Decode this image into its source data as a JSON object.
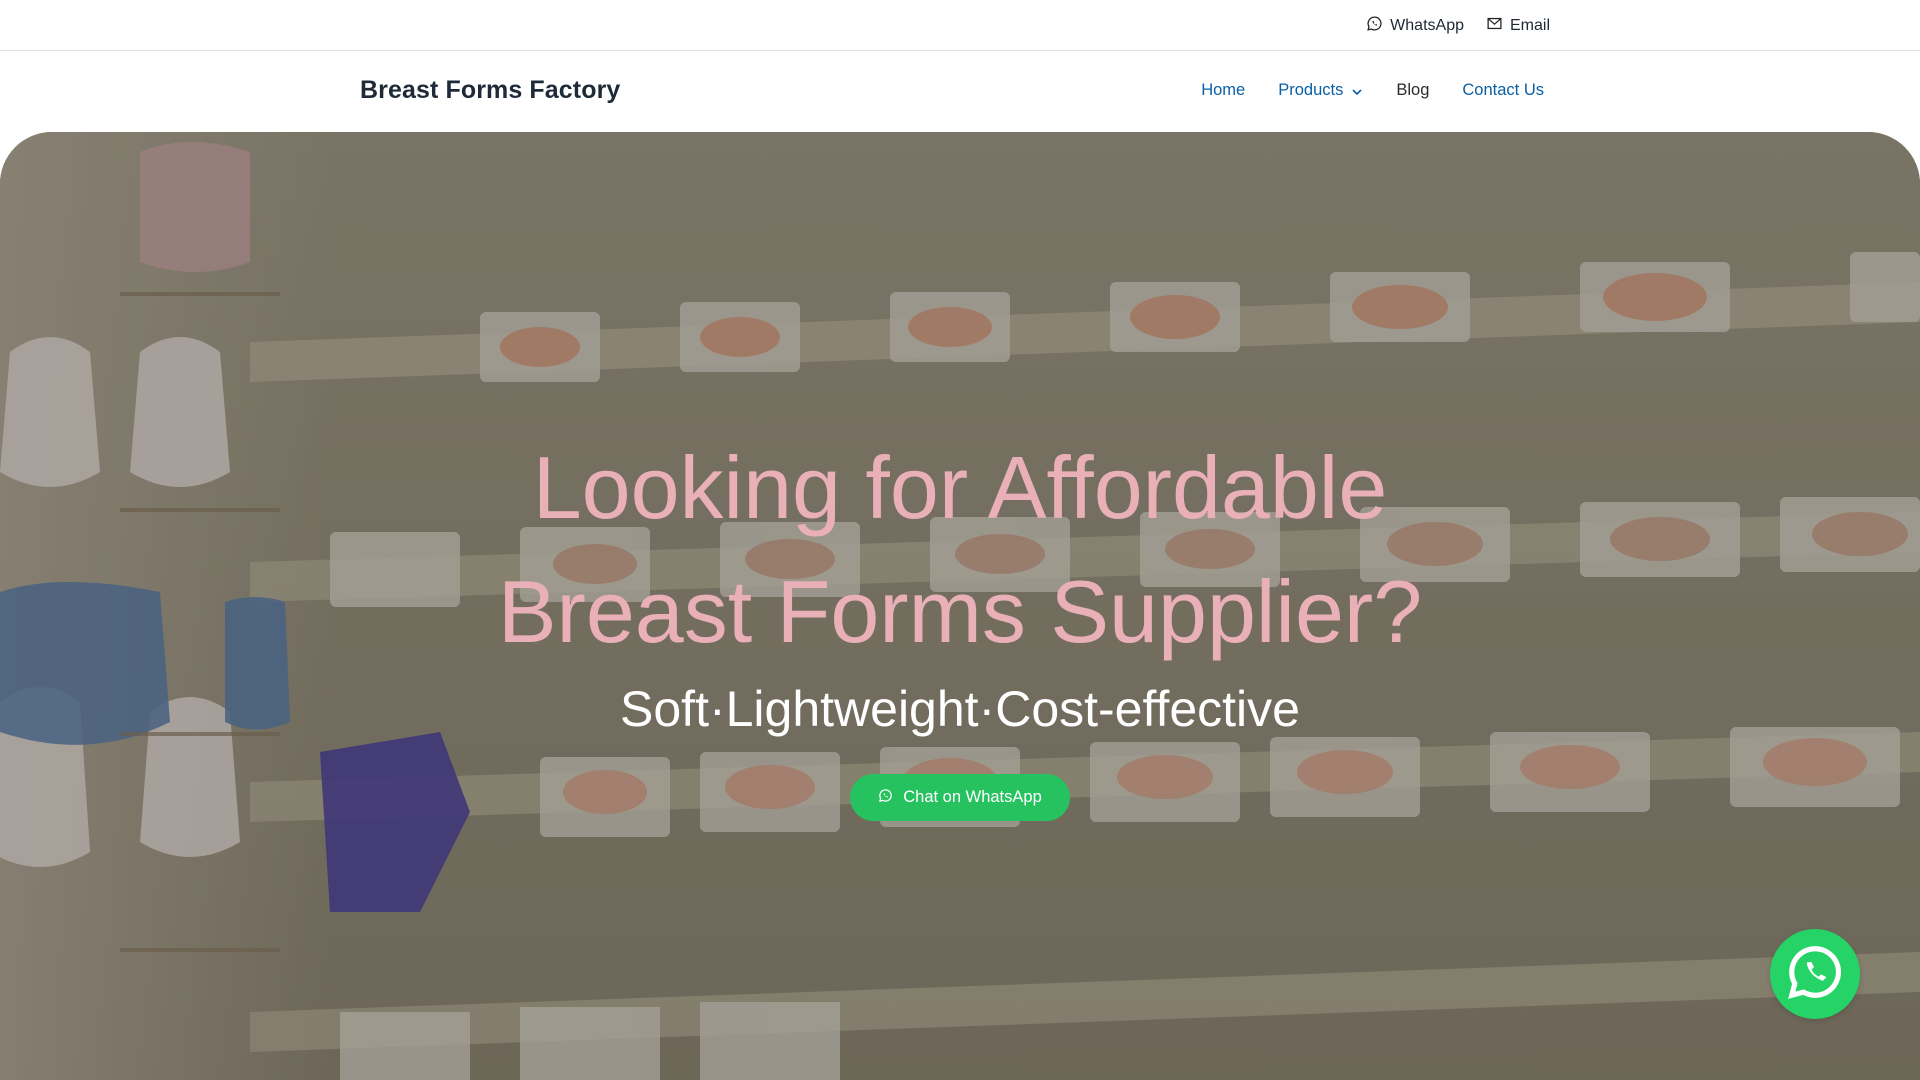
{
  "topbar": {
    "whatsapp_label": "WhatsApp",
    "email_label": "Email"
  },
  "header": {
    "brand": "Breast Forms Factory",
    "nav": {
      "home": "Home",
      "products": "Products",
      "blog": "Blog",
      "contact": "Contact Us"
    }
  },
  "hero": {
    "headline_line1": "Looking for Affordable",
    "headline_line2": "Breast Forms Supplier?",
    "subheadline": "Soft·Lightweight·Cost-effective",
    "cta_label": "Chat on WhatsApp"
  },
  "icons": {
    "topbar_whatsapp": "whatsapp-icon",
    "topbar_email": "mail-icon",
    "products_dropdown": "chevron-down-icon",
    "cta": "whatsapp-icon",
    "floating": "whatsapp-icon"
  },
  "colors": {
    "nav_link": "#0b5fa5",
    "headline": "#e9b0b7",
    "cta_background": "#25c25f",
    "floating_button": "#25d366"
  }
}
